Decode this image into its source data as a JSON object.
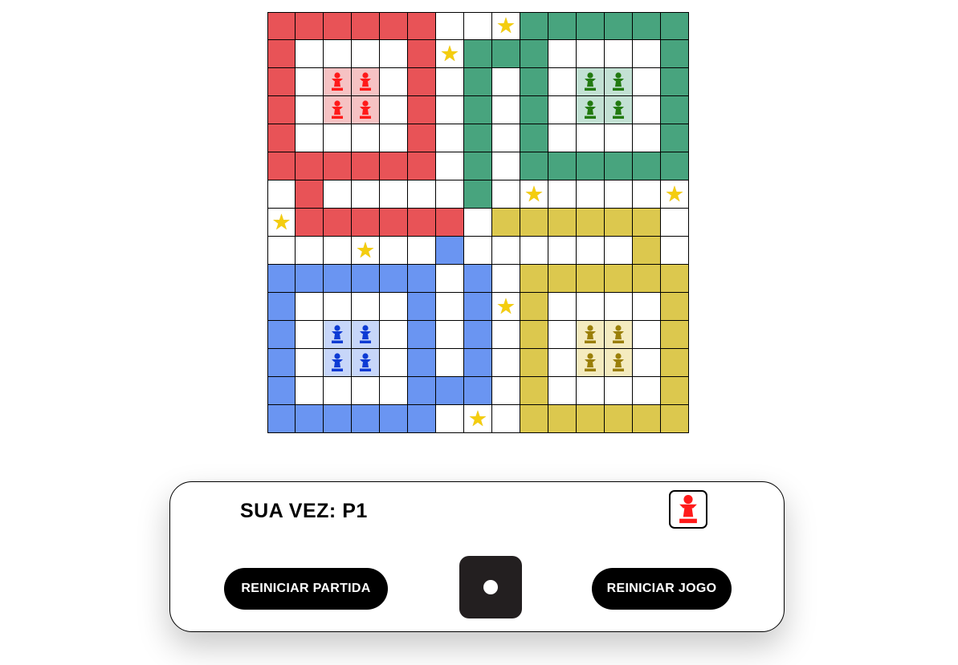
{
  "colors": {
    "red": "#e85357",
    "green": "#48a47e",
    "yellow": "#dcc84e",
    "blue": "#6a95f2",
    "white": "#ffffff",
    "star": "#f4cd0f"
  },
  "home_tints": {
    "red": "#f6c2c3",
    "green": "#c3e1d4",
    "yellow": "#f4ebbf",
    "blue": "#c7d6f9"
  },
  "piece_colors": {
    "red": "#ff1a1a",
    "green": "#237a11",
    "yellow": "#9a7f08",
    "blue": "#0d3bd4"
  },
  "board": {
    "size": 15,
    "rows": [
      "RRRRRRWWSGGGGGG",
      "RWWWWRSGGGWWWWG",
      "RWAAWRWGWGWBBWG",
      "RWAAWRWGWGWBBWG",
      "RWWWWRWGWGWWWWG",
      "RRRRRRWGWGGGGGG",
      "WRWWWWWGWSWWWWS",
      "SRRRRRRWYYYYYYW",
      "WWWSWWLWWWWWWYW",
      "LLLLLLWLWYYYYYY",
      "LWWWWLWLSYWWWWY",
      "LWDDWLWLWYWCCWY",
      "LWDDWLWLWYWCCWY",
      "LWWWWLLLWYWWWWY",
      "LLLLLLWSWYYYYYY"
    ],
    "legend": {
      "R": "red",
      "G": "green",
      "Y": "yellow",
      "L": "blue",
      "W": "white",
      "S": "star",
      "A": "red-home",
      "B": "green-home",
      "C": "yellow-home",
      "D": "blue-home"
    },
    "star_icon": "star-icon",
    "piece_icon": "pawn-icon"
  },
  "panel": {
    "turn_label": "SUA VEZ: P1",
    "turn_player_color": "red",
    "turn_icon": "pawn-icon",
    "restart_match_label": "REINICIAR PARTIDA",
    "restart_game_label": "REINICIAR JOGO",
    "dice_value": 1,
    "dice_icon": "dice-icon"
  }
}
